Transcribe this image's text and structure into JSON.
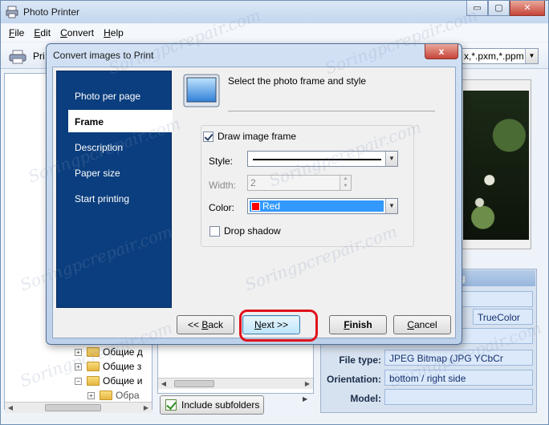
{
  "app": {
    "title": "Photo Printer",
    "window_buttons": {
      "minimize": "▭",
      "maximize": "▢",
      "close": "✕"
    }
  },
  "menu": {
    "items": [
      {
        "first": "F",
        "rest": "ile"
      },
      {
        "first": "E",
        "rest": "dit"
      },
      {
        "first": "C",
        "rest": "onvert"
      },
      {
        "first": "H",
        "rest": "elp"
      }
    ]
  },
  "toolbar": {
    "print_label": "Pri",
    "filter_text": "x,*.pxm,*.ppm"
  },
  "tree": {
    "items": [
      "Общие д",
      "Общие з",
      "Общие и",
      "Обра"
    ],
    "expanders": [
      "+",
      "+",
      "−",
      "+"
    ]
  },
  "subfolders": {
    "label": "Include subfolders"
  },
  "info": {
    "header": "ng",
    "values": {
      "color": "TrueColor",
      "file_type": "JPEG Bitmap (JPG YCbCr",
      "orientation": "bottom / right side",
      "model": ""
    },
    "labels": {
      "file_type": "File type:",
      "orientation": "Orientation:",
      "model": "Model:"
    }
  },
  "dialog": {
    "title": "Convert images to Print",
    "close_glyph": "x",
    "nav": [
      {
        "label": "Photo per page",
        "active": false
      },
      {
        "label": "Frame",
        "active": true
      },
      {
        "label": "Description",
        "active": false
      },
      {
        "label": "Paper size",
        "active": false
      },
      {
        "label": "Start printing",
        "active": false
      }
    ],
    "header_text": "Select the photo frame and style",
    "draw_frame_label": "Draw image frame",
    "style_label": "Style:",
    "width_label": "Width:",
    "width_value": "2",
    "color_label": "Color:",
    "color_value": "Red",
    "color_hex": "#ff0000",
    "drop_shadow_label": "Drop shadow",
    "buttons": {
      "back": {
        "pre": "<< ",
        "u": "B",
        "post": "ack"
      },
      "next": {
        "pre": "",
        "u": "N",
        "post": "ext >>"
      },
      "finish": {
        "pre": "",
        "u": "F",
        "post": "inish"
      },
      "cancel": {
        "pre": "",
        "u": "C",
        "post": "ancel"
      }
    }
  },
  "colors": {
    "nav_panel": "#0b3e7e",
    "highlight": "#e0121b",
    "selection": "#3399ff"
  }
}
